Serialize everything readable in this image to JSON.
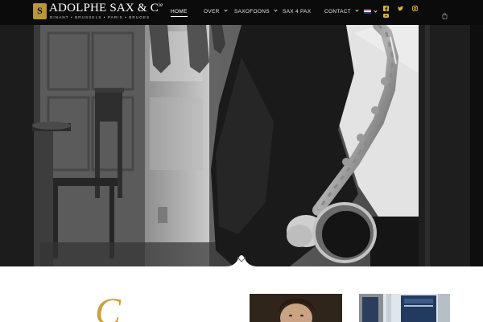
{
  "brand": {
    "name": "ADOLPHE SAX & C",
    "name_superscript": "ie",
    "cities": "DINANT • BRUSSELS • PARIS • BRUGES",
    "mark": "S"
  },
  "nav": {
    "items": [
      {
        "label": "HOME",
        "active": true,
        "has_dropdown": false
      },
      {
        "label": "OVER",
        "active": false,
        "has_dropdown": true
      },
      {
        "label": "SAXOFOONS",
        "active": false,
        "has_dropdown": true
      },
      {
        "label": "SAX 4 PAX",
        "active": false,
        "has_dropdown": false
      },
      {
        "label": "CONTACT",
        "active": false,
        "has_dropdown": true
      }
    ]
  },
  "language": {
    "selected": "nl",
    "icon": "flag-netherlands-icon"
  },
  "social": [
    "facebook-icon",
    "twitter-icon",
    "instagram-icon",
    "youtube-icon"
  ],
  "cart": {
    "icon": "shopping-bag-icon"
  },
  "hero": {
    "image": "black-and-white photo of a saxophonist in a suit holding a saxophone in a doorway",
    "scroll_icon": "chevron-down-icon"
  },
  "intro": {
    "script_title": "C",
    "images": [
      "portrait-painting",
      "storefront-photo"
    ]
  },
  "colors": {
    "header_bg": "#0b0b0b",
    "accent_gold": "#c9a13f",
    "text_light": "#e6e6e6",
    "social_gold": "#d6b04a"
  }
}
